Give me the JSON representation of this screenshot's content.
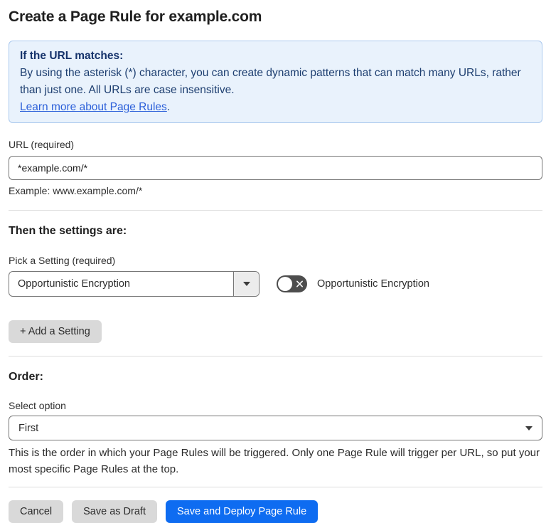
{
  "page": {
    "title": "Create a Page Rule for example.com"
  },
  "info_banner": {
    "heading": "If the URL matches:",
    "body": "By using the asterisk (*) character, you can create dynamic patterns that can match many URLs, rather than just one. All URLs are case insensitive.",
    "link_label": "Learn more about Page Rules",
    "link_suffix": "."
  },
  "url_section": {
    "label": "URL (required)",
    "value": "*example.com/*",
    "helper": "Example: www.example.com/*"
  },
  "settings_section": {
    "heading": "Then the settings are:",
    "picker_label": "Pick a Setting (required)",
    "picker_value": "Opportunistic Encryption",
    "toggle_label": "Opportunistic Encryption",
    "toggle_state": "off",
    "add_button_label": "+ Add a Setting"
  },
  "order_section": {
    "heading": "Order:",
    "select_label": "Select option",
    "select_value": "First",
    "helper": "This is the order in which your Page Rules will be triggered. Only one Page Rule will trigger per URL, so put your most specific Page Rules at the top."
  },
  "footer": {
    "cancel_label": "Cancel",
    "save_draft_label": "Save as Draft",
    "save_deploy_label": "Save and Deploy Page Rule"
  },
  "colors": {
    "info_banner_bg": "#e9f2fc",
    "info_banner_border": "#abc9ee",
    "info_text": "#1d3e70",
    "link": "#2b5fd9",
    "primary_button": "#0e6cf1",
    "secondary_button": "#d9d9d9",
    "toggle_off_bg": "#4d4d4d"
  }
}
